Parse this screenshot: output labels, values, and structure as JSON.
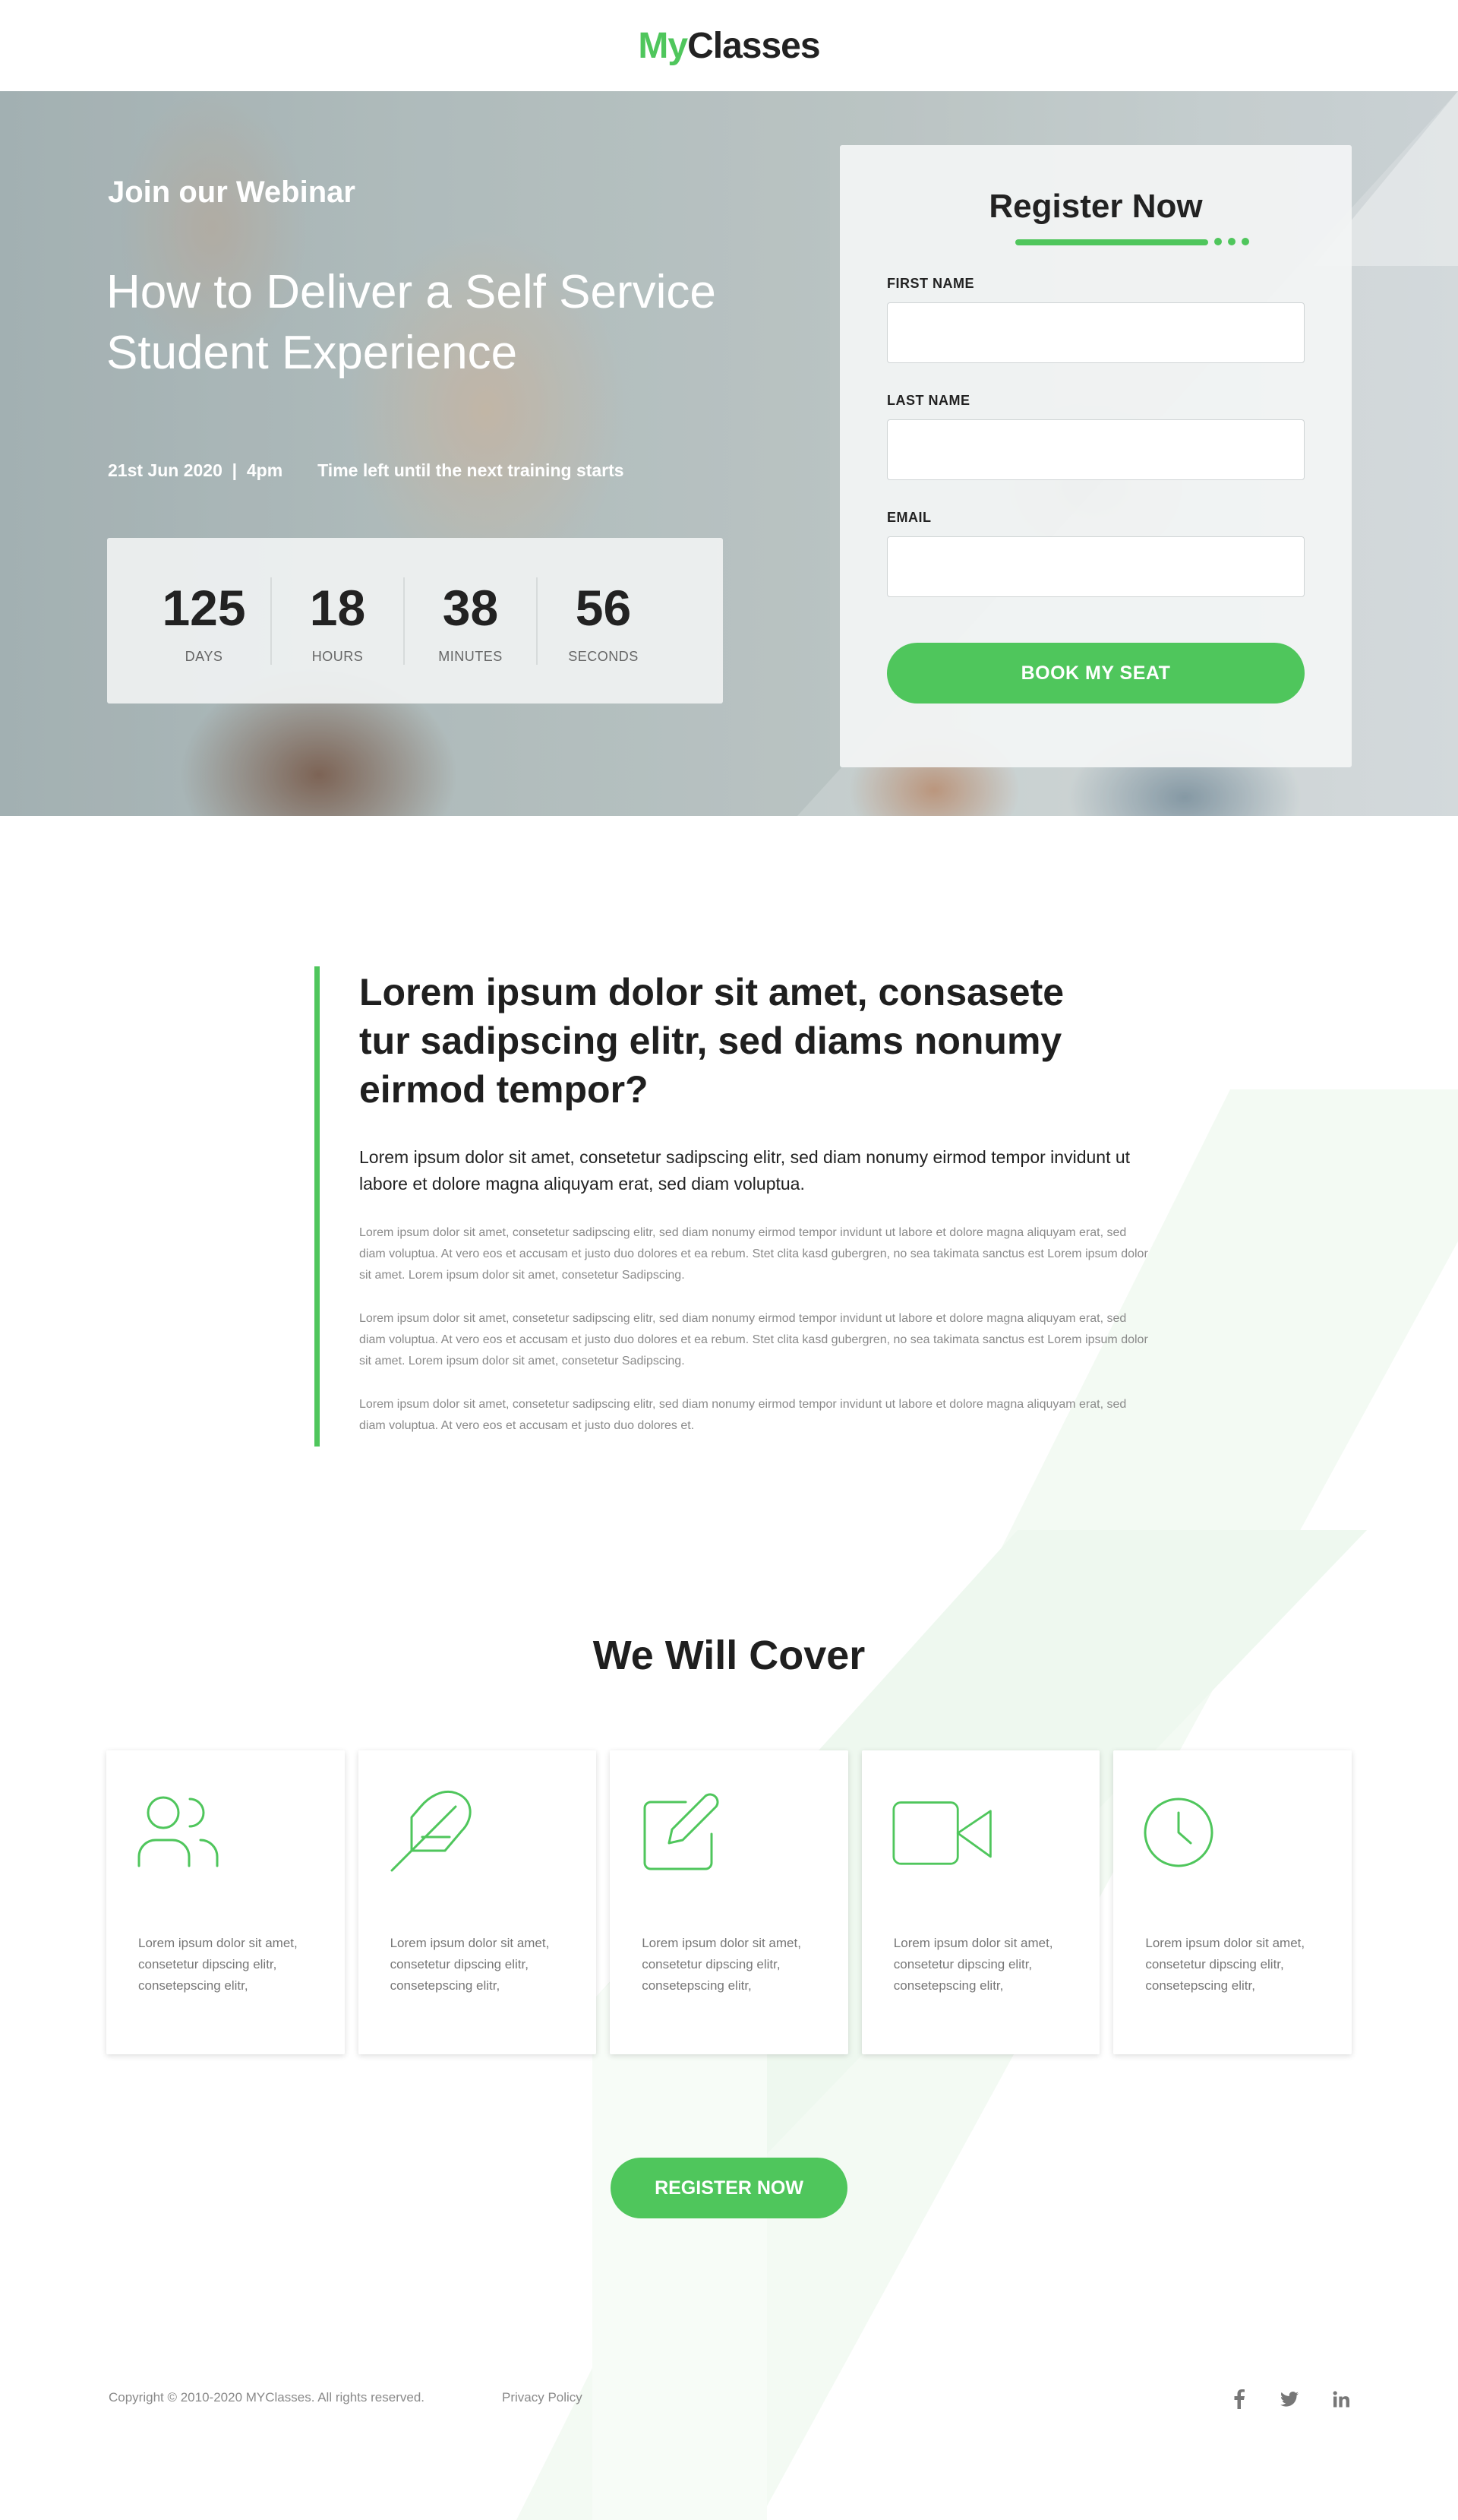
{
  "brand": {
    "logo_prefix": "My",
    "logo_suffix": "Classes"
  },
  "hero": {
    "kicker": "Join our Webinar",
    "title": "How to Deliver a Self Service Student Experience",
    "date": "21st Jun 2020  |  4pm",
    "countdown_caption": "Time left until the next training starts",
    "countdown": [
      {
        "value": "125",
        "label": "DAYS"
      },
      {
        "value": "18",
        "label": "HOURS"
      },
      {
        "value": "38",
        "label": "MINUTES"
      },
      {
        "value": "56",
        "label": "SECONDS"
      }
    ]
  },
  "register_form": {
    "title": "Register Now",
    "first_name_label": "FIRST NAME",
    "last_name_label": "LAST NAME",
    "email_label": "EMAIL",
    "first_name_value": "",
    "last_name_value": "",
    "email_value": "",
    "submit_label": "BOOK MY SEAT"
  },
  "article": {
    "heading": "Lorem ipsum dolor sit amet, consasete tur sadipscing elitr, sed diams nonumy eirmod tempor?",
    "lead": "Lorem ipsum dolor sit amet, consetetur sadipscing elitr, sed diam nonumy eirmod tempor invidunt ut labore et dolore magna aliquyam erat, sed diam voluptua.",
    "paragraphs": [
      "Lorem ipsum dolor sit amet, consetetur sadipscing elitr, sed diam nonumy eirmod tempor invidunt ut labore et dolore magna aliquyam erat, sed diam voluptua. At vero eos et accusam et justo duo dolores et ea rebum. Stet clita kasd gubergren, no sea takimata sanctus est Lorem ipsum dolor sit amet. Lorem ipsum dolor sit amet, consetetur Sadipscing.",
      "Lorem ipsum dolor sit amet, consetetur sadipscing elitr, sed diam nonumy eirmod tempor invidunt ut labore et dolore magna aliquyam erat, sed diam voluptua. At vero eos et accusam et justo duo dolores et ea rebum. Stet clita kasd gubergren, no sea takimata sanctus est Lorem ipsum dolor sit amet. Lorem ipsum dolor sit amet, consetetur Sadipscing.",
      "Lorem ipsum dolor sit amet, consetetur sadipscing elitr, sed diam nonumy eirmod tempor invidunt ut labore et dolore magna aliquyam erat, sed diam voluptua. At vero eos et accusam et justo duo dolores et."
    ]
  },
  "cover": {
    "title": "We Will Cover",
    "cards": [
      {
        "icon": "users-icon",
        "text": "Lorem ipsum dolor sit amet, consetetur dipscing elitr,  consetepscing elitr,"
      },
      {
        "icon": "feather-icon",
        "text": "Lorem ipsum dolor sit amet, consetetur dipscing elitr,  consetepscing elitr,"
      },
      {
        "icon": "edit-icon",
        "text": "Lorem ipsum dolor sit amet, consetetur dipscing elitr,  consetepscing elitr,"
      },
      {
        "icon": "video-icon",
        "text": "Lorem ipsum dolor sit amet, consetetur dipscing elitr,  consetepscing elitr,"
      },
      {
        "icon": "clock-icon",
        "text": "Lorem ipsum dolor sit amet, consetetur dipscing elitr,  consetepscing elitr,"
      }
    ],
    "cta_label": "REGISTER NOW"
  },
  "footer": {
    "copyright": "Copyright ©  2010-2020 MYClasses. All rights reserved.",
    "privacy_label": "Privacy Policy",
    "social": [
      {
        "icon": "facebook-icon",
        "glyph": "f"
      },
      {
        "icon": "twitter-icon",
        "glyph": "t"
      },
      {
        "icon": "linkedin-icon",
        "glyph": "in"
      }
    ]
  },
  "colors": {
    "accent": "#4fc65c",
    "text_dark": "#1f1f1f",
    "text_muted": "#8a8a8a"
  }
}
